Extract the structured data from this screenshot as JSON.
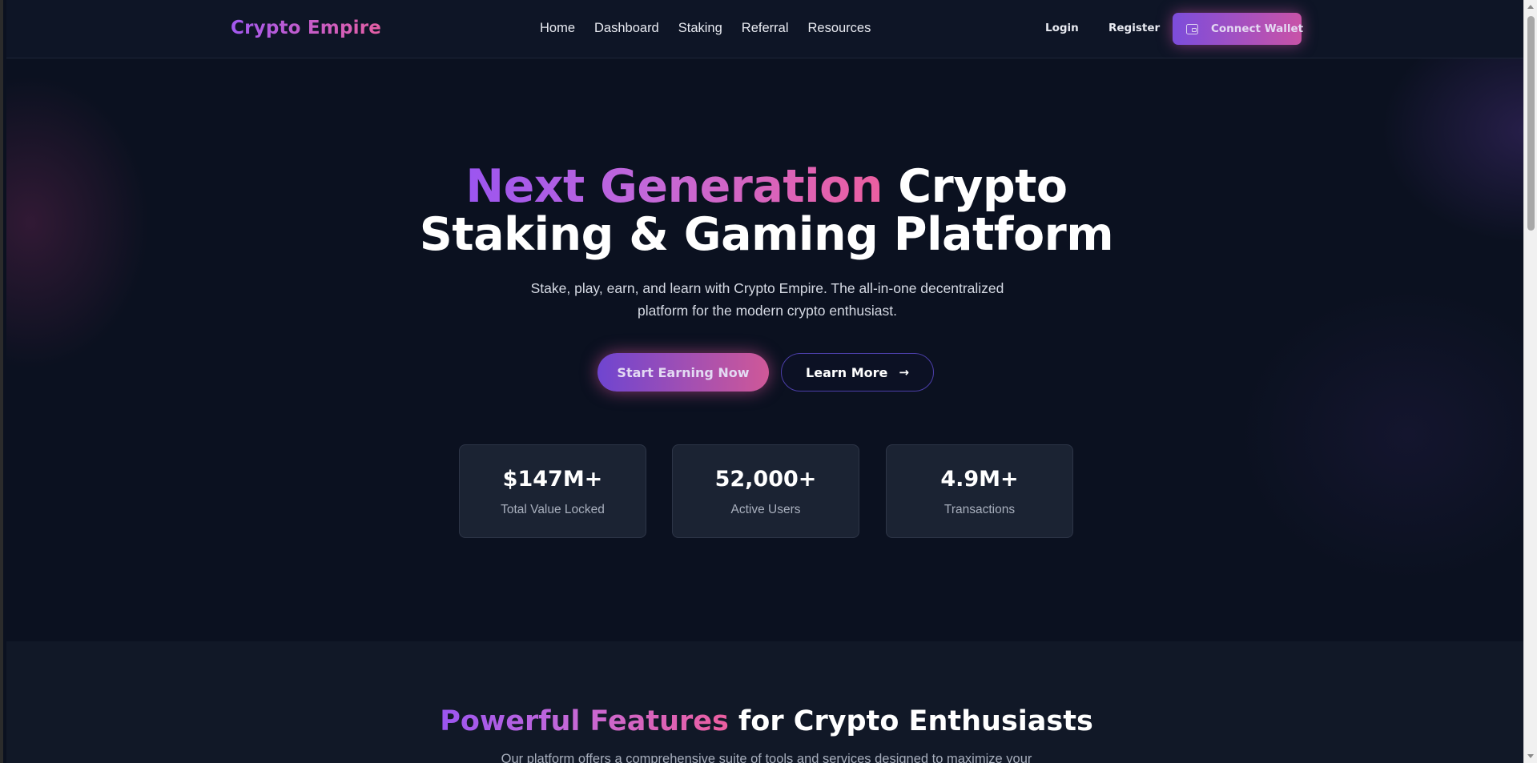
{
  "header": {
    "brand": "Crypto Empire",
    "nav": [
      "Home",
      "Dashboard",
      "Staking",
      "Referral",
      "Resources"
    ],
    "login": "Login",
    "register": "Register",
    "connect_wallet": "Connect Wallet",
    "connect_icon": "wallet-icon"
  },
  "hero": {
    "title_highlight": "Next Generation",
    "title_rest_line1": " Crypto",
    "title_line2": "Staking & Gaming Platform",
    "subtitle": "Stake, play, earn, and learn with Crypto Empire. The all-in-one decentralized platform for the modern crypto enthusiast.",
    "primary_cta": "Start Earning Now",
    "secondary_cta": "Learn More",
    "secondary_icon": "arrow-right-icon",
    "arrow_glyph": "→",
    "stats": [
      {
        "value": "$147M+",
        "label": "Total Value Locked"
      },
      {
        "value": "52,000+",
        "label": "Active Users"
      },
      {
        "value": "4.9M+",
        "label": "Transactions"
      }
    ]
  },
  "features": {
    "title_highlight": "Powerful Features",
    "title_rest": " for Crypto Enthusiasts",
    "subtitle": "Our platform offers a comprehensive suite of tools and services designed to maximize your"
  },
  "colors": {
    "background": "#0b1120",
    "accent_purple": "#9b55f0",
    "accent_pink": "#ec5fa0",
    "card": "#1b2333"
  }
}
